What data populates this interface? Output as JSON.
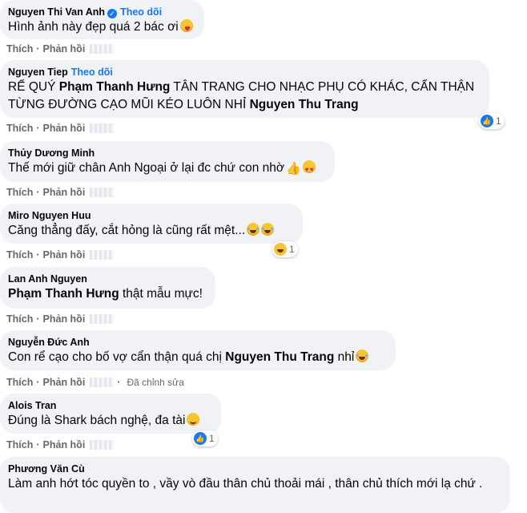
{
  "actions": {
    "like": "Thích",
    "reply": "Phản hồi",
    "sep": "·",
    "edited": "Đã chỉnh sửa"
  },
  "comments": [
    {
      "author": "Nguyen Thi Van Anh",
      "follow": "Theo dõi",
      "text": "Hình ảnh này đẹp quá 2 bác ơi",
      "emoji": "winking-kiss-emoji"
    },
    {
      "author": "Nguyen Tiep",
      "follow": "Theo dõi",
      "text_a": "RỂ QUÝ ",
      "mention_1": "Phạm Thanh Hưng",
      "text_b": " TÂN TRANG CHO NHẠC PHỤ CÓ KHÁC, CẨN THẬN TỪNG ĐƯỜNG CẠO MŨI KÉO LUÔN NHỈ ",
      "mention_2": "Nguyen Thu Trang",
      "reaction": {
        "type": "like",
        "count": "1"
      }
    },
    {
      "author": "Thủy Dương Minh",
      "text": "Thế mới giữ chân Anh Ngoại ở lại đc chứ con nhờ"
    },
    {
      "author": "Miro Nguyen Huu",
      "text": "Căng thẳng đấy, cắt hỏng là cũng rất mệt...",
      "reaction": {
        "type": "haha",
        "count": "1"
      }
    },
    {
      "author": "Lan Anh Nguyen",
      "mention": "Phạm Thanh Hưng",
      "text": " thật mẫu mực!"
    },
    {
      "author": "Nguyễn Đức Anh",
      "text_a": "Con rể cạo cho bố vợ cẩn thận quá chị ",
      "mention": "Nguyen Thu Trang",
      "text_b": " nhỉ"
    },
    {
      "author": "Alois Tran",
      "text": "Đúng là Shark bách nghệ, đa tài",
      "reaction": {
        "type": "like",
        "count": "1"
      }
    },
    {
      "author": "Phương Văn Cù",
      "text": "Làm anh hớt tóc quyền to , vầy vò đầu thân chủ thoải mái , thân chủ thích mới lạ chứ ."
    }
  ],
  "colors": {
    "bubble": "#f0f2f5",
    "link": "#1877f2",
    "meta": "#65676b"
  }
}
